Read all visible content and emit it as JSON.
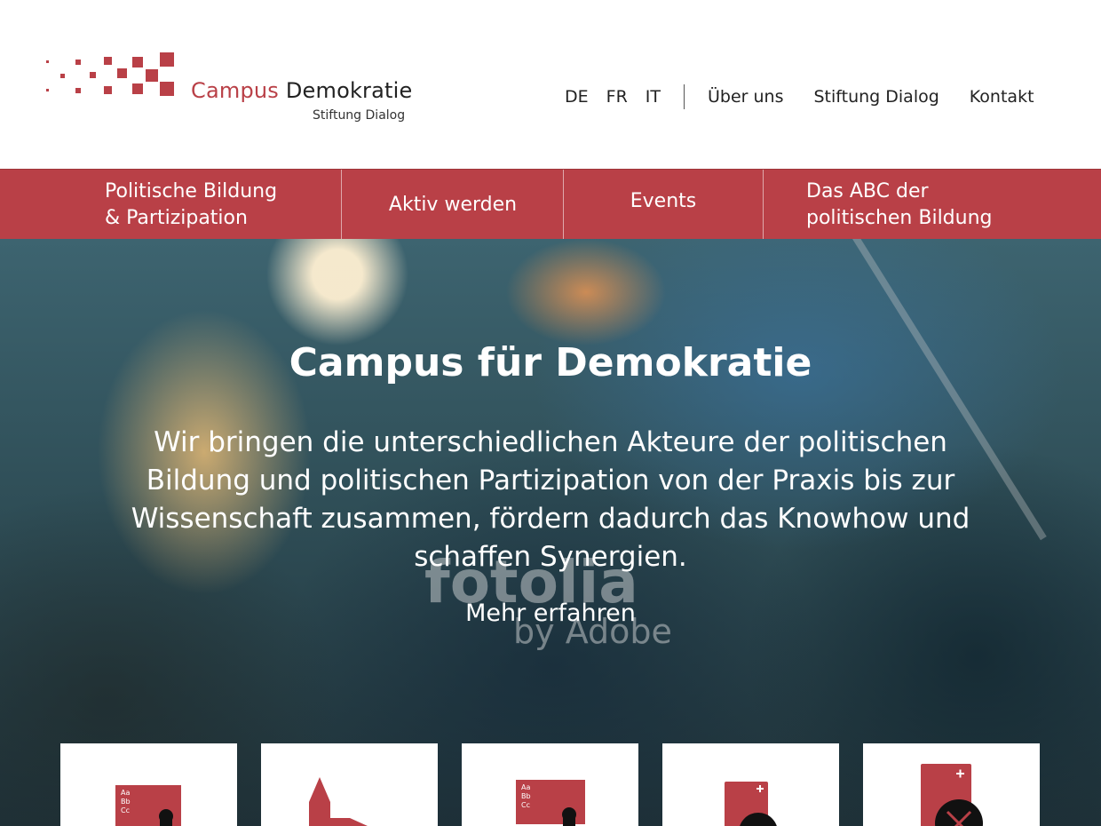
{
  "brand": {
    "name_part1": "Campus",
    "name_part2": "Demokratie",
    "subtitle": "Stiftung Dialog",
    "color_primary": "#b94047"
  },
  "topnav": {
    "languages": [
      "DE",
      "FR",
      "IT"
    ],
    "links": [
      "Über uns",
      "Stiftung Dialog",
      "Kontakt"
    ]
  },
  "mainnav": {
    "items": [
      {
        "line1": "Politische Bildung",
        "line2": "& Partizipation"
      },
      {
        "line1": "Aktiv werden",
        "line2": ""
      },
      {
        "line1": "Events",
        "line2": ""
      },
      {
        "line1": "Das ABC der",
        "line2": "politischen Bildung"
      }
    ]
  },
  "hero": {
    "title": "Campus für Demokratie",
    "text": "Wir bringen die unterschiedlichen Akteure der politischen Bildung und politischen Partizipation von der Praxis bis zur Wissenschaft zusammen, fördern dadurch das Knowhow und schaffen Synergien.",
    "cta": "Mehr erfahren",
    "watermark_line1": "fotolia",
    "watermark_line2": "by Adobe"
  },
  "cards": {
    "icons": [
      "abc-board-person-icon",
      "church-building-icon",
      "abc-board-person-icon",
      "ballot-vote-icon",
      "ballot-vote-icon"
    ],
    "abc_labels": [
      "Aa",
      "Bb",
      "Cc"
    ]
  }
}
